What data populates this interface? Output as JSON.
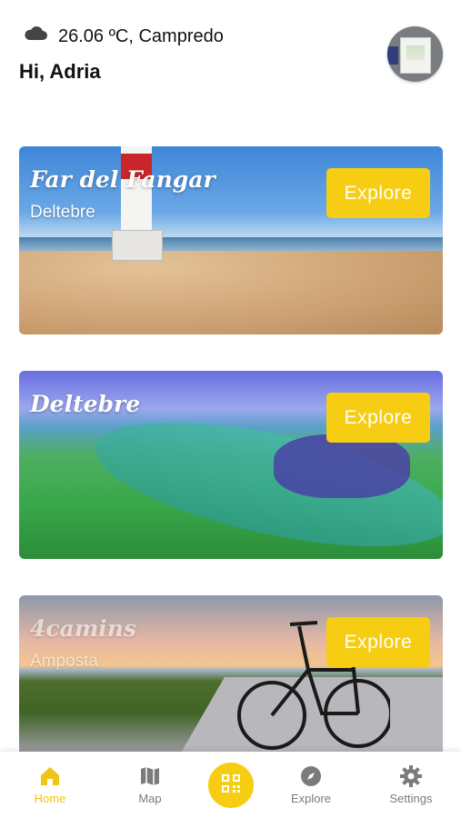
{
  "header": {
    "weather_icon": "cloud-icon",
    "weather_text": "26.06 ºC, Campredo",
    "greeting": "Hi, Adria"
  },
  "cards": [
    {
      "title": "Far del Fangar",
      "subtitle": "Deltebre",
      "button_label": "Explore"
    },
    {
      "title": "Deltebre",
      "subtitle": "",
      "button_label": "Explore"
    },
    {
      "title": "4camins",
      "subtitle": "Amposta",
      "button_label": "Explore"
    }
  ],
  "bottom_nav": {
    "items": [
      {
        "label": "Home",
        "icon": "home-icon",
        "active": true
      },
      {
        "label": "Map",
        "icon": "map-icon",
        "active": false
      },
      {
        "label": "",
        "icon": "qr-code-icon",
        "active": false
      },
      {
        "label": "Explore",
        "icon": "compass-icon",
        "active": false
      },
      {
        "label": "Settings",
        "icon": "gear-icon",
        "active": false
      }
    ]
  },
  "colors": {
    "accent": "#f6cd12",
    "inactive": "#7b7b7b",
    "text": "#111111"
  }
}
